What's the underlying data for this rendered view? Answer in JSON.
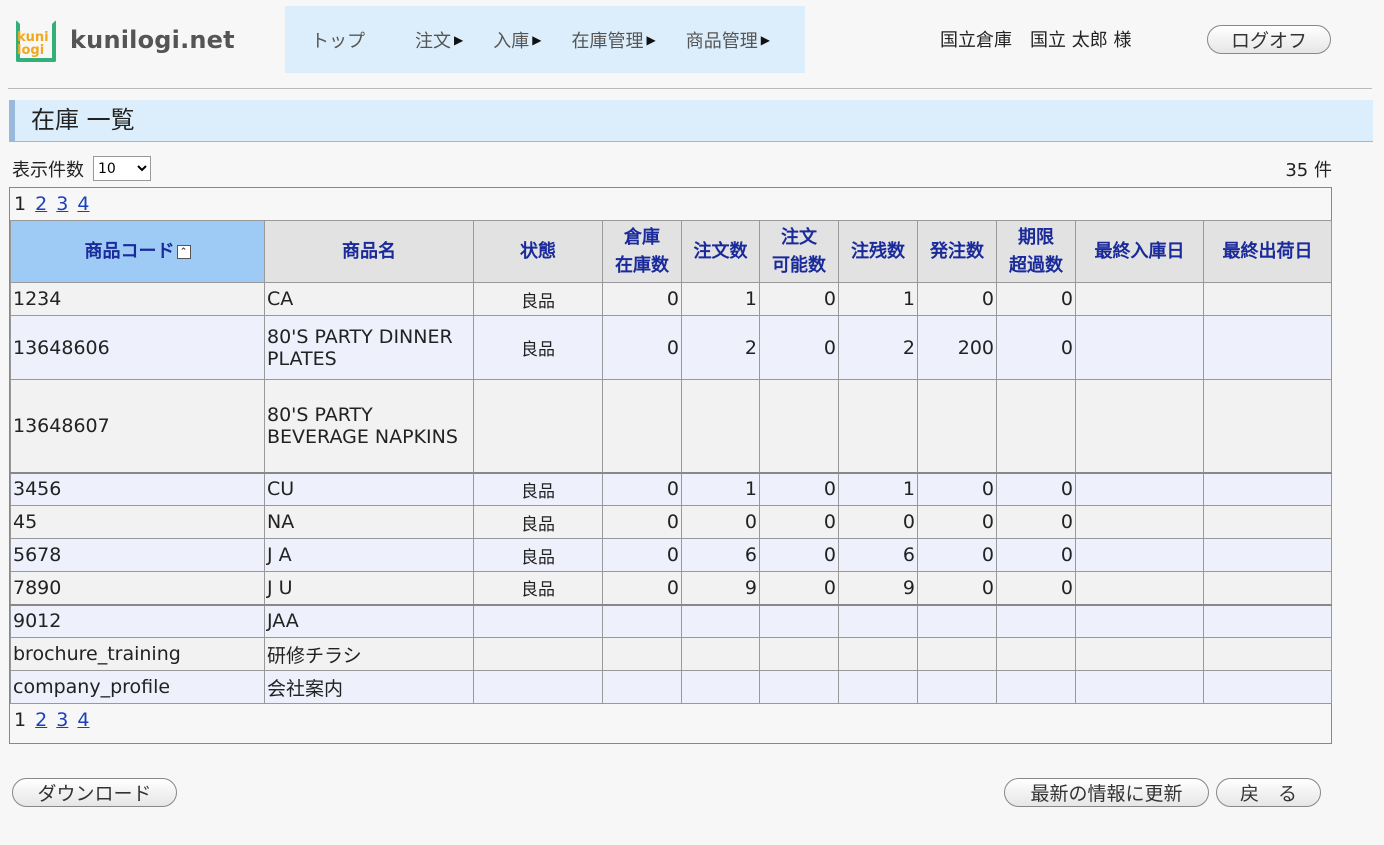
{
  "logo": {
    "mark_line1": "kuni",
    "mark_line2": "logi",
    "text": "kunilogi.net"
  },
  "nav": {
    "items": [
      {
        "label": "トップ",
        "has_arrow": false
      },
      {
        "label": "注文",
        "has_arrow": true
      },
      {
        "label": "入庫",
        "has_arrow": true
      },
      {
        "label": "在庫管理",
        "has_arrow": true
      },
      {
        "label": "商品管理",
        "has_arrow": true
      }
    ]
  },
  "user": {
    "warehouse": "国立倉庫",
    "name": "国立 太郎 様"
  },
  "logoff_label": "ログオフ",
  "page_title": "在庫 一覧",
  "display_count": {
    "label": "表示件数",
    "selected": "10",
    "options": [
      "10"
    ]
  },
  "total": "35 件",
  "pager": {
    "current": "1",
    "links": [
      "2",
      "3",
      "4"
    ]
  },
  "table": {
    "headers": [
      [
        "商品コード"
      ],
      [
        "商品名"
      ],
      [
        "状態"
      ],
      [
        "倉庫",
        "在庫数"
      ],
      [
        "注文数"
      ],
      [
        "注文",
        "可能数"
      ],
      [
        "注残数"
      ],
      [
        "発注数"
      ],
      [
        "期限",
        "超過数"
      ],
      [
        "最終入庫日"
      ],
      [
        "最終出荷日"
      ]
    ],
    "rows": [
      [
        "1234",
        "CA",
        "良品",
        "0",
        "1",
        "0",
        "1",
        "0",
        "0",
        "",
        ""
      ],
      [
        "13648606",
        "80'S PARTY DINNER PLATES",
        "良品",
        "0",
        "2",
        "0",
        "2",
        "200",
        "0",
        "",
        ""
      ],
      [
        "13648607",
        "80'S PARTY BEVERAGE NAPKINS",
        "",
        "",
        "",
        "",
        "",
        "",
        "",
        "",
        ""
      ],
      [
        "3456",
        "CU",
        "良品",
        "0",
        "1",
        "0",
        "1",
        "0",
        "0",
        "",
        ""
      ],
      [
        "45",
        "NA",
        "良品",
        "0",
        "0",
        "0",
        "0",
        "0",
        "0",
        "",
        ""
      ],
      [
        "5678",
        "J A",
        "良品",
        "0",
        "6",
        "0",
        "6",
        "0",
        "0",
        "",
        ""
      ],
      [
        "7890",
        "J U",
        "良品",
        "0",
        "9",
        "0",
        "9",
        "0",
        "0",
        "",
        ""
      ],
      [
        "9012",
        "JAA",
        "",
        "",
        "",
        "",
        "",
        "",
        "",
        "",
        ""
      ],
      [
        "brochure_training",
        "研修チラシ",
        "",
        "",
        "",
        "",
        "",
        "",
        "",
        "",
        ""
      ],
      [
        "company_profile",
        "会社案内",
        "",
        "",
        "",
        "",
        "",
        "",
        "",
        "",
        ""
      ]
    ]
  },
  "buttons": {
    "download": "ダウンロード",
    "refresh": "最新の情報に更新",
    "back": "戻　る"
  }
}
